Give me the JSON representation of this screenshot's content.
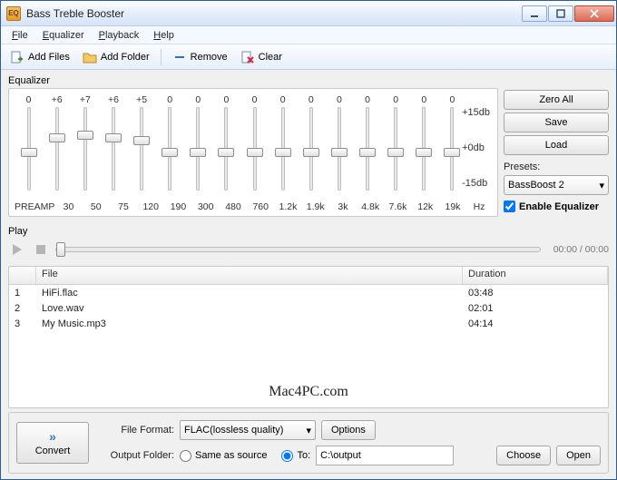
{
  "window": {
    "title": "Bass Treble Booster",
    "app_icon_text": "EQ"
  },
  "menus": {
    "file": "File",
    "equalizer": "Equalizer",
    "playback": "Playback",
    "help": "Help"
  },
  "toolbar": {
    "add_files": "Add Files",
    "add_folder": "Add Folder",
    "remove": "Remove",
    "clear": "Clear"
  },
  "equalizer": {
    "label": "Equalizer",
    "preamp_label": "PREAMP",
    "hz_label": "Hz",
    "db_labels": [
      "+15db",
      "+0db",
      "-15db"
    ],
    "bands": [
      {
        "freq": "30",
        "gain": "+6"
      },
      {
        "freq": "50",
        "gain": "+7"
      },
      {
        "freq": "75",
        "gain": "+6"
      },
      {
        "freq": "120",
        "gain": "+5"
      },
      {
        "freq": "190",
        "gain": "0"
      },
      {
        "freq": "300",
        "gain": "0"
      },
      {
        "freq": "480",
        "gain": "0"
      },
      {
        "freq": "760",
        "gain": "0"
      },
      {
        "freq": "1.2k",
        "gain": "0"
      },
      {
        "freq": "1.9k",
        "gain": "0"
      },
      {
        "freq": "3k",
        "gain": "0"
      },
      {
        "freq": "4.8k",
        "gain": "0"
      },
      {
        "freq": "7.6k",
        "gain": "0"
      },
      {
        "freq": "12k",
        "gain": "0"
      },
      {
        "freq": "19k",
        "gain": "0"
      }
    ],
    "preamp_gain": "0",
    "side": {
      "zero_all": "Zero All",
      "save": "Save",
      "load": "Load",
      "presets_label": "Presets:",
      "preset_value": "BassBoost 2",
      "enable_label": "Enable Equalizer",
      "enable_checked": true
    }
  },
  "play": {
    "label": "Play",
    "time": "00:00 / 00:00"
  },
  "filelist": {
    "columns": {
      "num": "",
      "file": "File",
      "duration": "Duration"
    },
    "rows": [
      {
        "num": "1",
        "file": "HiFi.flac",
        "duration": "03:48"
      },
      {
        "num": "2",
        "file": "Love.wav",
        "duration": "02:01"
      },
      {
        "num": "3",
        "file": "My Music.mp3",
        "duration": "04:14"
      }
    ],
    "watermark": "Mac4PC.com"
  },
  "bottom": {
    "convert": "Convert",
    "file_format_label": "File Format:",
    "file_format_value": "FLAC(lossless quality)",
    "options": "Options",
    "output_folder_label": "Output Folder:",
    "same_as_source": "Same as source",
    "to_label": "To:",
    "to_selected": true,
    "output_path": "C:\\output",
    "choose": "Choose",
    "open": "Open"
  }
}
